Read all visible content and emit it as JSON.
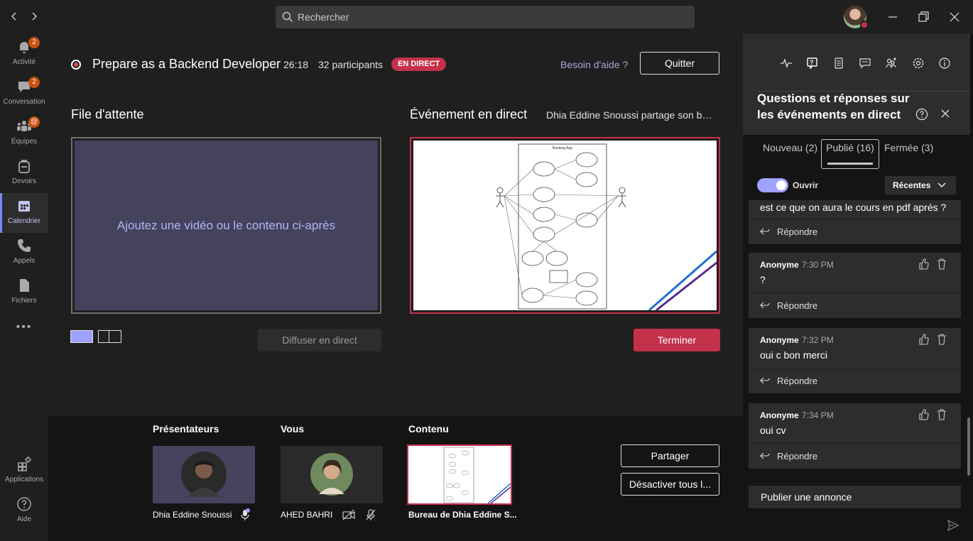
{
  "titlebar": {
    "search_placeholder": "Rechercher"
  },
  "rail": {
    "items": [
      {
        "label": "Activité",
        "badge": "2"
      },
      {
        "label": "Conversation",
        "badge": "2"
      },
      {
        "label": "Équipes",
        "badge": "@"
      },
      {
        "label": "Devoirs"
      },
      {
        "label": "Calendrier"
      },
      {
        "label": "Appels"
      },
      {
        "label": "Fichiers"
      },
      {
        "label": "Applications"
      },
      {
        "label": "Aide"
      }
    ],
    "more": "•••"
  },
  "header": {
    "title": "Prepare as a Backend Developer",
    "timer": "26:18",
    "participants": "32 participants",
    "live_badge": "EN DIRECT",
    "help_link": "Besoin d'aide ?",
    "quit_label": "Quitter"
  },
  "queue": {
    "heading": "File d'attente",
    "placeholder": "Ajoutez une vidéo ou le contenu ci-après",
    "broadcast_label": "Diffuser en direct"
  },
  "live": {
    "heading": "Événement en direct",
    "sharing_text": "Dhia Eddine Snoussi partage son bureau",
    "end_label": "Terminer"
  },
  "bottom": {
    "presenters_heading": "Présentateurs",
    "you_heading": "Vous",
    "content_heading": "Contenu",
    "presenter_name": "Dhia Eddine Snoussi",
    "you_name": "AHED BAHRI",
    "content_name": "Bureau de Dhia Eddine S...",
    "share_label": "Partager",
    "mute_all_label": "Désactiver tous l..."
  },
  "panel": {
    "title": "Questions et réponses sur les événements en direct",
    "tabs": {
      "new": "Nouveau (2)",
      "published": "Publié (16)",
      "closed": "Fermée (3)"
    },
    "toggle_label": "Ouvrir",
    "sort_label": "Récentes",
    "reply_label": "Répondre",
    "partial_question": "est ce que on aura le cours en pdf aprés ?",
    "questions": [
      {
        "author": "Anonyme",
        "time": "7:30 PM",
        "text": "?"
      },
      {
        "author": "Anonyme",
        "time": "7:32 PM",
        "text": "oui c bon merci"
      },
      {
        "author": "Anonyme",
        "time": "7:34 PM",
        "text": "oui cv"
      }
    ],
    "announce_label": "Publier une annonce"
  },
  "colors": {
    "accent": "#7f85f5",
    "live_red": "#c4314b",
    "panel_bg": "#141414"
  }
}
